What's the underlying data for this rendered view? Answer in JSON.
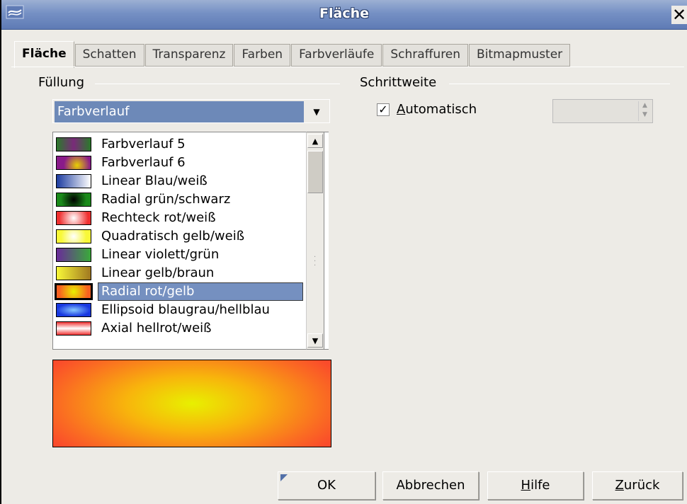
{
  "window": {
    "title": "Fläche"
  },
  "tabs": [
    "Fläche",
    "Schatten",
    "Transparenz",
    "Farben",
    "Farbverläufe",
    "Schraffuren",
    "Bitmapmuster"
  ],
  "fill_group": {
    "title": "Füllung",
    "selected_type": "Farbverlauf"
  },
  "step_group": {
    "title": "Schrittweite",
    "auto_label": "utomatisch",
    "auto_mnemonic": "A",
    "auto_checked": true,
    "step_value": ""
  },
  "gradients": [
    {
      "label": "Farbverlauf 5",
      "swatch": "linear-gradient(to right, #2a7a2a, #7a2a7a, #2a7a2a)"
    },
    {
      "label": "Farbverlauf 6",
      "swatch": "radial-gradient(circle at 60% 70%, #e8d000 0%, #8a1a8a 60%)"
    },
    {
      "label": "Linear Blau/weiß",
      "swatch": "linear-gradient(to right, #1c3ca0, #ffffff)"
    },
    {
      "label": "Radial grün/schwarz",
      "swatch": "radial-gradient(circle, #000 0%, #1a8a1a 70%)"
    },
    {
      "label": "Rechteck rot/weiß",
      "swatch": "radial-gradient(circle, #fff 0%, #f03030 80%)"
    },
    {
      "label": "Quadratisch gelb/weiß",
      "swatch": "radial-gradient(circle, #fff 0%, #f8f838 70%)"
    },
    {
      "label": "Linear violett/grün",
      "swatch": "linear-gradient(to right, #6a2a9a, #3aaa3a)"
    },
    {
      "label": "Linear gelb/braun",
      "swatch": "linear-gradient(to right, #f8f838, #a07820)"
    },
    {
      "label": "Radial rot/gelb",
      "swatch": "radial-gradient(circle, #e8f000 0%, #f86020 80%)"
    },
    {
      "label": "Ellipsoid blaugrau/hellblau",
      "swatch": "radial-gradient(ellipse, #88c8ff 0%, #1838e0 70%)"
    },
    {
      "label": "Axial hellrot/weiß",
      "swatch": "linear-gradient(to bottom, #f03030, #fff, #f03030)"
    }
  ],
  "selected_gradient_index": 8,
  "buttons": {
    "ok": "OK",
    "cancel": "Abbrechen",
    "help": "ilfe",
    "help_mnemonic": "H",
    "back": "urück",
    "back_mnemonic": "Z"
  }
}
